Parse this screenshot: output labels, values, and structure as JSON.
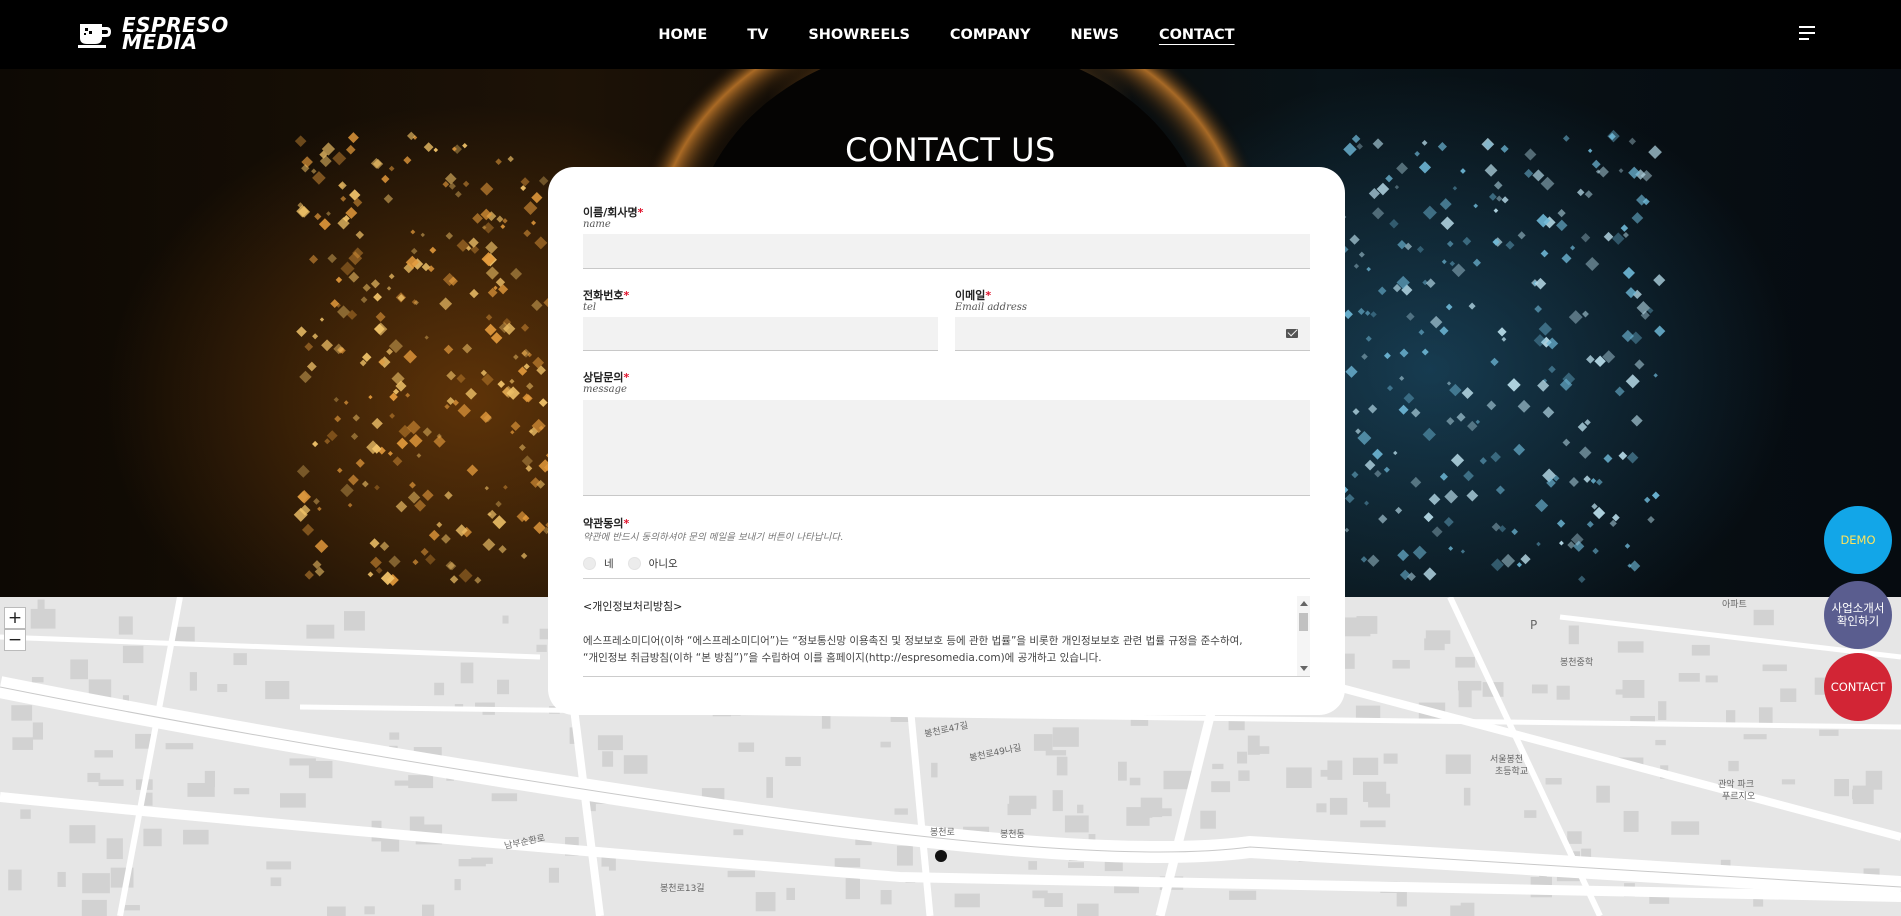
{
  "header": {
    "logo_line1": "ESPRESO",
    "logo_line2": "MEDIA",
    "nav": [
      "HOME",
      "TV",
      "SHOWREELS",
      "COMPANY",
      "NEWS",
      "CONTACT"
    ],
    "active_nav": "CONTACT",
    "menu_icon": "hamburger-icon"
  },
  "hero": {
    "title": "CONTACT US"
  },
  "form": {
    "name": {
      "label": "이름/회사명",
      "required_mark": "*",
      "sub": "name",
      "value": ""
    },
    "tel": {
      "label": "전화번호",
      "required_mark": "*",
      "sub": "tel",
      "value": ""
    },
    "email": {
      "label": "이메일",
      "required_mark": "*",
      "sub": "Email address",
      "value": "",
      "icon": "envelope-icon"
    },
    "message": {
      "label": "상담문의",
      "required_mark": "*",
      "sub": "message",
      "value": ""
    },
    "agree": {
      "label": "약관동의",
      "required_mark": "*",
      "sub": "약관에 반드시 동의하셔야 문의 메일을 보내기 버튼이 나타납니다.",
      "options": [
        "네",
        "아니오"
      ]
    },
    "privacy": {
      "title": "<개인정보처리방침>",
      "line1": "에스프레소미디어(이하 “에스프레소미디어”)는 “정보통신망 이용촉진 및 정보보호 등에 관한 법률”을 비롯한 개인정보보호 관련 법률 규정을 준수하여,",
      "line2": "“개인정보 취급방침(이하 “본 방침”)”을 수립하여 이를 홈페이지(http://espresomedia.com)에 공개하고 있습니다."
    }
  },
  "map": {
    "zoom_in": "+",
    "zoom_out": "−",
    "labels": [
      "아파트",
      "남부순환로",
      "봉천로",
      "봉천로47길",
      "봉천로49나길",
      "봉천동",
      "봉천중학교",
      "서울봉천초등학교",
      "관악파크푸르지오",
      "봉천로13길",
      "P"
    ]
  },
  "floating": {
    "demo": "DEMO",
    "brochure_line1": "사업소개서",
    "brochure_line2": "확인하기",
    "contact": "CONTACT",
    "colors": {
      "demo_bg": "#12a6e8",
      "demo_text": "#ffe45c",
      "brochure_bg": "#5a5d8f",
      "contact_bg": "#d22535"
    }
  }
}
